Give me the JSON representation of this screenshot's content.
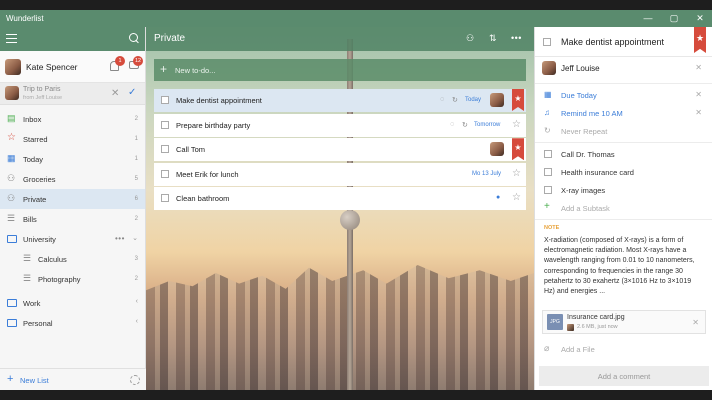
{
  "window": {
    "title": "Wunderlist",
    "minimize_glyph": "—",
    "maximize_glyph": "▢",
    "close_glyph": "✕"
  },
  "colors": {
    "accent_green": "#5a8b6e",
    "accent_blue": "#3b7dd8",
    "star_red": "#d64b3c",
    "note_orange": "#e8a23a"
  },
  "sidebar": {
    "user": {
      "name": "Kate Spencer",
      "notifications_count": "1",
      "messages_count": "12"
    },
    "invite": {
      "title": "Trip to Paris",
      "subtitle": "from Jeff Louise",
      "decline_glyph": "✕",
      "accept_glyph": "✓"
    },
    "items": [
      {
        "label": "Inbox",
        "count": "2",
        "icon": "inbox-icon",
        "glyph": "▤"
      },
      {
        "label": "Starred",
        "count": "1",
        "icon": "star-icon",
        "glyph": "☆"
      },
      {
        "label": "Today",
        "count": "1",
        "icon": "calendar-today-icon",
        "glyph": "▦"
      },
      {
        "label": "Groceries",
        "count": "5",
        "icon": "shared-users-icon",
        "glyph": "⚇"
      },
      {
        "label": "Private",
        "count": "6",
        "icon": "shared-users-icon",
        "glyph": "⚇"
      },
      {
        "label": "Bills",
        "count": "2",
        "icon": "list-icon",
        "glyph": "☰"
      }
    ],
    "folders": [
      {
        "label": "University",
        "more_glyph": "•••",
        "chevron": "⌄",
        "children": [
          {
            "label": "Calculus",
            "count": "3"
          },
          {
            "label": "Photography",
            "count": "2"
          }
        ]
      },
      {
        "label": "Work",
        "chevron": "‹"
      },
      {
        "label": "Personal",
        "chevron": "‹"
      }
    ],
    "new_list_label": "New List"
  },
  "main": {
    "title": "Private",
    "add_todo_placeholder": "New to-do...",
    "tasks": [
      {
        "title": "Make dentist appointment",
        "due": "Today",
        "starred": true,
        "selected": true
      },
      {
        "title": "Prepare birthday party",
        "due": "Tomorrow",
        "starred": false
      },
      {
        "title": "Call Tom",
        "due": "",
        "starred": true
      },
      {
        "title": "Meet Erik for lunch",
        "due": "Mo 13 July",
        "starred": false
      },
      {
        "title": "Clean bathroom",
        "due": "",
        "starred": false
      }
    ]
  },
  "detail": {
    "title": "Make dentist appointment",
    "assignee": "Jeff Louise",
    "due": "Due Today",
    "reminder": "Remind me 10 AM",
    "repeat": "Never Repeat",
    "subtasks": [
      "Call Dr. Thomas",
      "Health insurance card",
      "X-ray images"
    ],
    "add_subtask_label": "Add a Subtask",
    "note_label": "NOTE",
    "note_text": "X-radiation (composed of X-rays) is a form of electromagnetic radiation. Most X-rays have a wavelength ranging from 0.01 to 10 nanometers, corresponding to frequencies in the range 30 petahertz to 30 exahertz (3×1016 Hz to 3×1019 Hz) and energies ...",
    "file": {
      "name": "Insurance card.jpg",
      "meta": "2.6 MB, just now",
      "type": "JPG"
    },
    "add_file_label": "Add a File",
    "comment_placeholder": "Add a comment"
  }
}
